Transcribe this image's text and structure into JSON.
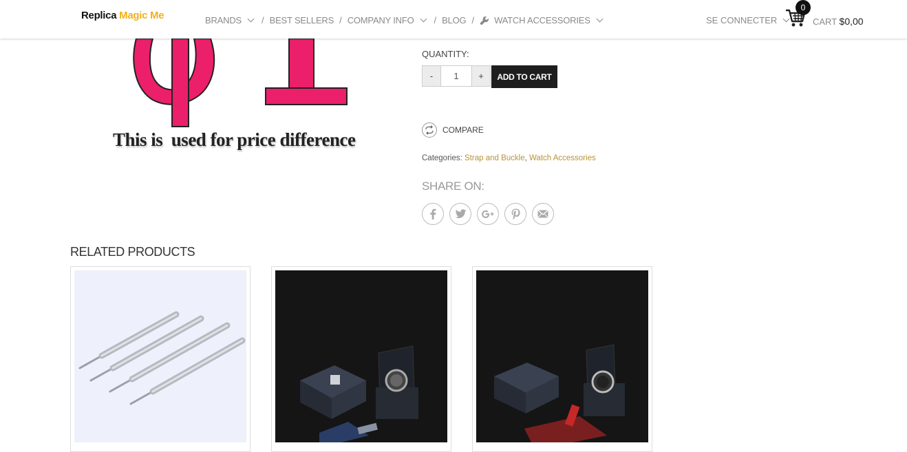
{
  "header": {
    "logo_part1": "Replica",
    "logo_part2": "Magic Me",
    "nav": [
      {
        "label": "BRANDS"
      },
      {
        "label": "BEST SELLERS"
      },
      {
        "label": "COMPANY INFO"
      },
      {
        "label": "BLOG"
      },
      {
        "label": "WATCH ACCESSORIES"
      }
    ],
    "account_label": "SE CONNECTER",
    "cart_count": "0",
    "cart_label": "CART",
    "cart_total": "$0,00"
  },
  "product": {
    "image_caption": "This is  used for price difference",
    "quantity_label": "QUANTITY:",
    "quantity_value": "1",
    "minus_label": "-",
    "plus_label": "+",
    "add_to_cart": "ADD TO CART",
    "compare_label": "COMPARE",
    "categories_prefix": "Categories:",
    "categories": [
      "Strap and Buckle",
      "Watch Accessories"
    ],
    "categories_sep": ", ",
    "share_title": "SHARE ON:",
    "share_networks": [
      "facebook-icon",
      "twitter-icon",
      "google-plus-icon",
      "pinterest-icon",
      "email-icon"
    ]
  },
  "related": {
    "title": "RELATED PRODUCTS",
    "products": [
      {
        "image": "spring-bar-tools"
      },
      {
        "image": "tag-heuer-watch-box"
      },
      {
        "image": "patek-philippe-watch-box"
      }
    ]
  },
  "colors": {
    "accent": "#f3b118",
    "link": "#b8923a",
    "price_symbol": "#ec1f6a",
    "button": "#1e1e1e"
  }
}
